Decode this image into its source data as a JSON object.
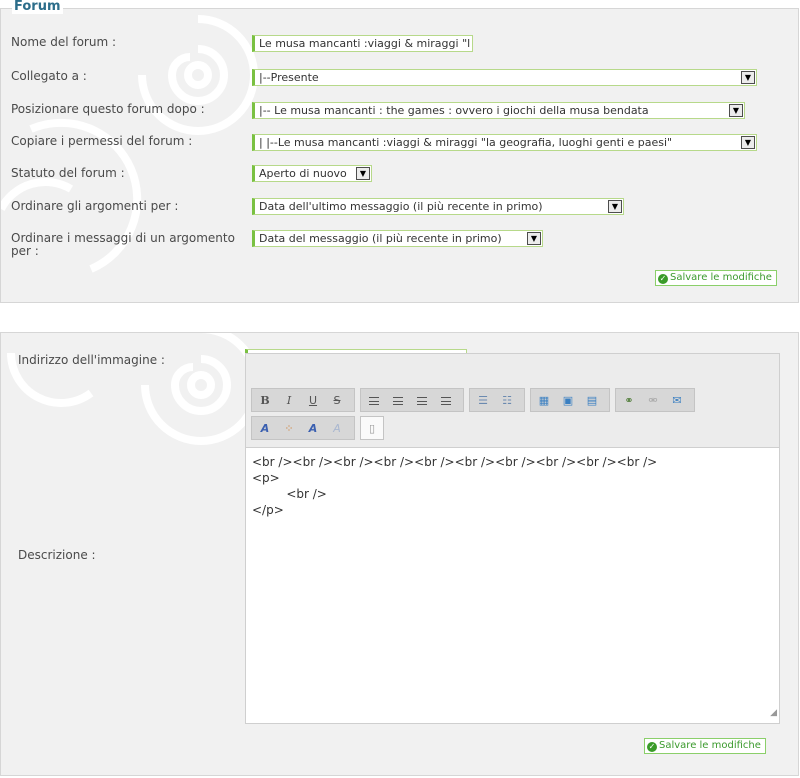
{
  "forum_panel": {
    "legend": "Forum",
    "fields": {
      "name": {
        "label": "Nome del forum :",
        "value": "Le musa mancanti :viaggi & miraggi \"l"
      },
      "linked": {
        "label": "Collegato a :",
        "value": "|--Presente"
      },
      "position": {
        "label": "Posizionare questo forum dopo :",
        "value": "|-- Le musa mancanti : the games : ovvero i giochi della musa bendata"
      },
      "permissions": {
        "label": "Copiare i permessi del forum :",
        "value": "|   |--Le musa mancanti :viaggi & miraggi \"la geografia, luoghi genti e paesi\""
      },
      "status": {
        "label": "Statuto del forum :",
        "value": "Aperto di nuovo"
      },
      "order_topics": {
        "label": "Ordinare gli argomenti per :",
        "value": "Data dell'ultimo messaggio (il più recente in primo)"
      },
      "order_messages": {
        "label": "Ordinare i messaggi di un argomento per :",
        "value": "Data del messaggio (il più recente in primo)"
      }
    },
    "save_label": "Salvare le modifiche"
  },
  "description_panel": {
    "image_url": {
      "label": "Indirizzo dell'immagine :",
      "value": ""
    },
    "description_label": "Descrizione :",
    "toolbar": {
      "bold": "B",
      "italic": "I",
      "underline": "U",
      "strike": "S",
      "icons": [
        "bold-icon",
        "italic-icon",
        "underline-icon",
        "strikethrough-icon",
        "align-left-icon",
        "align-center-icon",
        "align-right-icon",
        "justify-icon",
        "bullet-list-icon",
        "numbered-list-icon",
        "insert-table-icon",
        "insert-image-icon",
        "insert-media-icon",
        "link-icon",
        "unlink-icon",
        "email-icon",
        "font-size-icon",
        "color-icon",
        "font-family-icon",
        "remove-format-icon",
        "source-icon"
      ]
    },
    "editor_lines": [
      "<br /><br /><br /><br /><br /><br /><br /><br /><br /><br />",
      "<p>",
      "         <br />",
      "</p>"
    ],
    "save_label": "Salvare le modifiche"
  },
  "colors": {
    "accent_green": "#7ac142",
    "legend_blue": "#2c6d8a",
    "panel_bg": "#f1f1f1"
  }
}
